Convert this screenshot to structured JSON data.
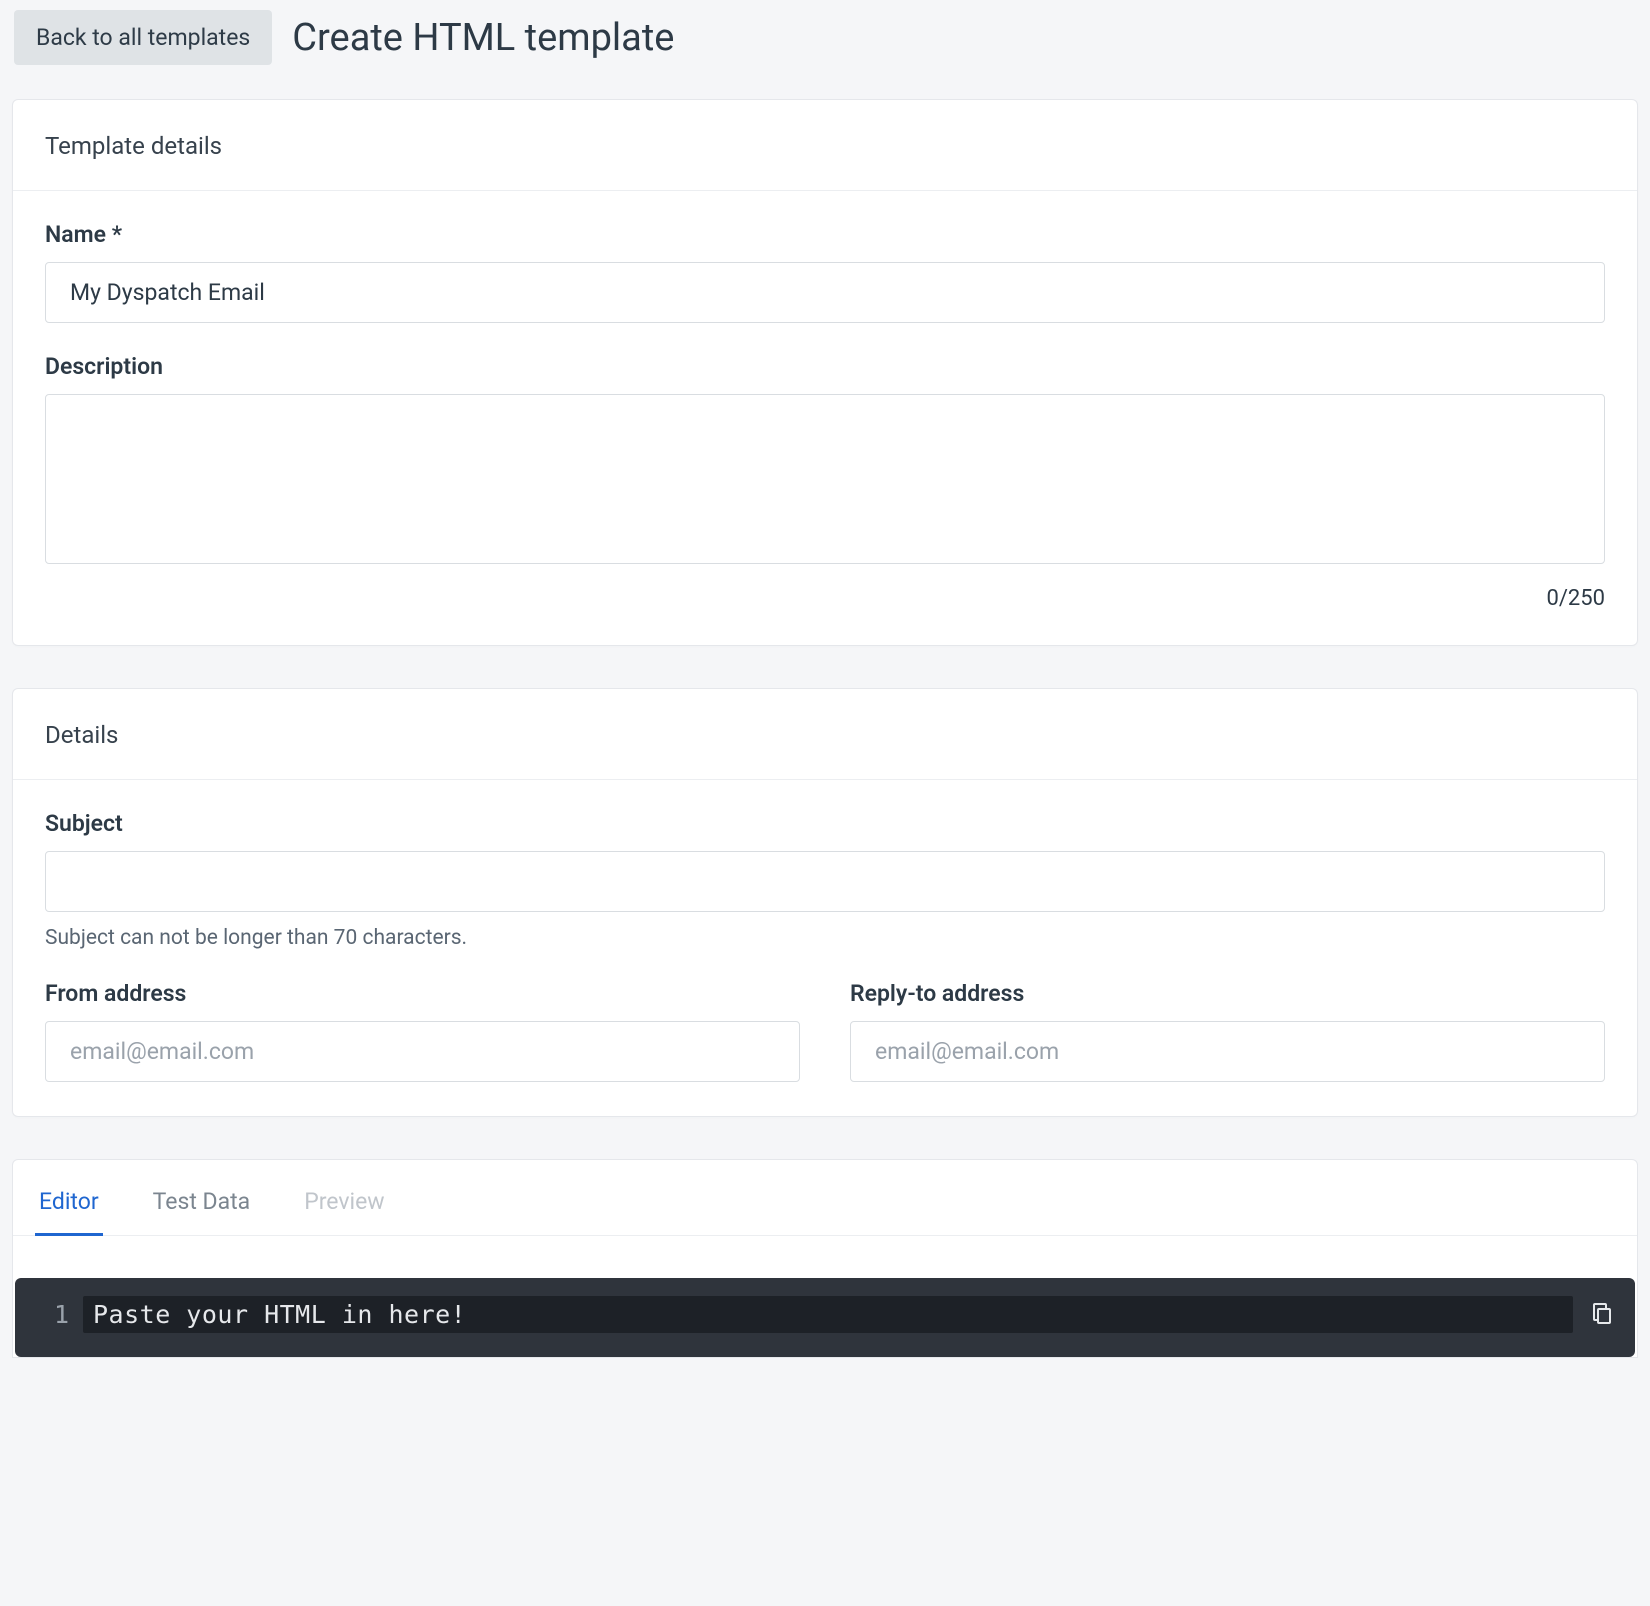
{
  "header": {
    "back_label": "Back to all templates",
    "page_title": "Create HTML template"
  },
  "card_template_details": {
    "title": "Template details",
    "name_label": "Name *",
    "name_value": "My Dyspatch Email",
    "description_label": "Description",
    "description_value": "",
    "char_count": "0/250"
  },
  "card_details": {
    "title": "Details",
    "subject_label": "Subject",
    "subject_value": "",
    "subject_helper": "Subject can not be longer than 70 characters.",
    "from_label": "From address",
    "from_placeholder": "email@email.com",
    "from_value": "",
    "reply_label": "Reply-to address",
    "reply_placeholder": "email@email.com",
    "reply_value": ""
  },
  "editor": {
    "tabs": {
      "editor": "Editor",
      "test_data": "Test Data",
      "preview": "Preview"
    },
    "line_number": "1",
    "placeholder_line": "Paste your HTML in here!"
  }
}
